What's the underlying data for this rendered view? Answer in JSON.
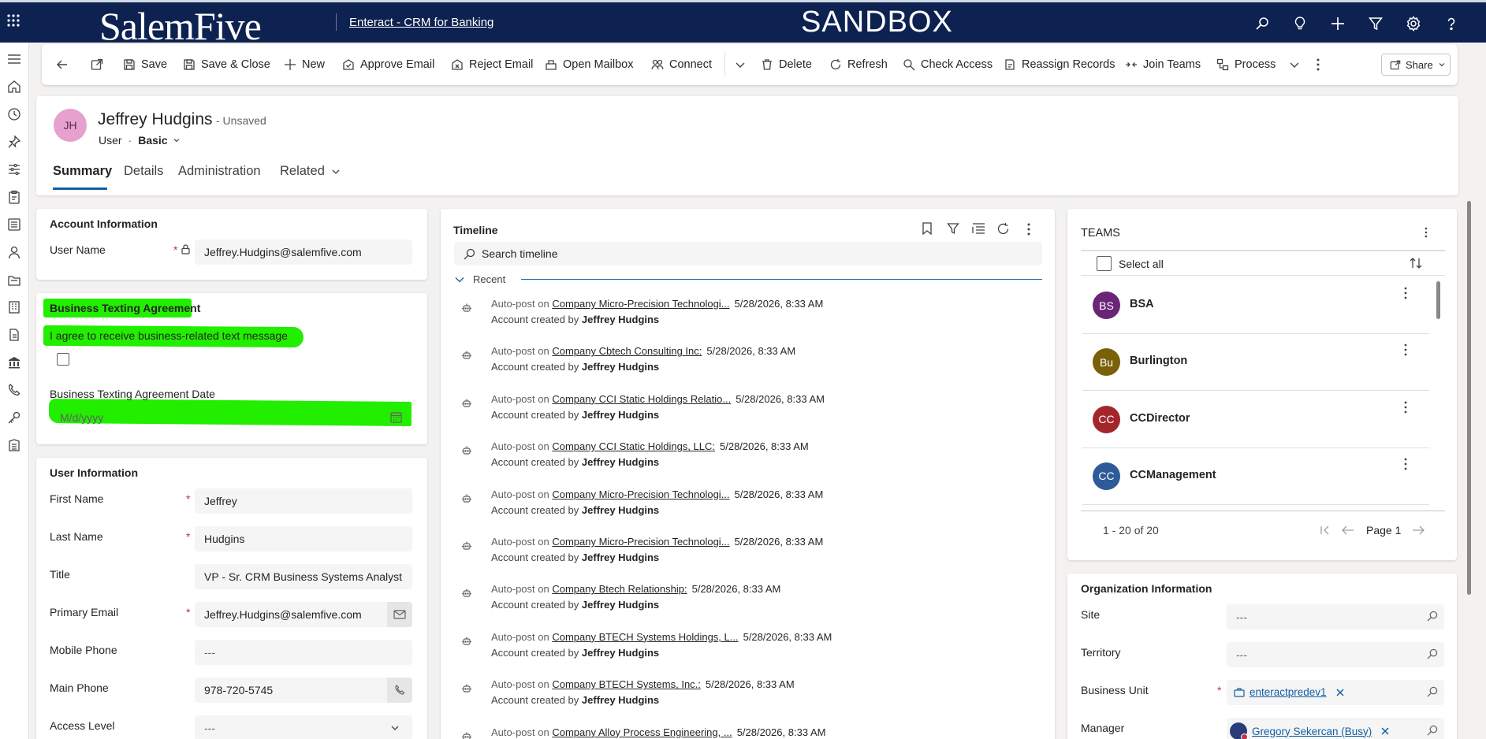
{
  "topbar": {
    "logo": "SalemFive",
    "app_name": "Enteract - CRM for Banking",
    "environment": "SANDBOX",
    "icons": [
      "search-icon",
      "lightbulb-icon",
      "plus-icon",
      "filter-icon",
      "gear-icon",
      "help-icon"
    ]
  },
  "commands": {
    "save": "Save",
    "save_close": "Save & Close",
    "new": "New",
    "approve_email": "Approve Email",
    "reject_email": "Reject Email",
    "open_mailbox": "Open Mailbox",
    "connect": "Connect",
    "delete": "Delete",
    "refresh": "Refresh",
    "check_access": "Check Access",
    "reassign_records": "Reassign Records",
    "join_teams": "Join Teams",
    "process": "Process",
    "share": "Share"
  },
  "header": {
    "initials": "JH",
    "full_name": "Jeffrey Hudgins",
    "status": "- Unsaved",
    "entity": "User",
    "separator": "·",
    "form": "Basic",
    "avatar_color": "#e6a1cf"
  },
  "tabs": [
    "Summary",
    "Details",
    "Administration",
    "Related"
  ],
  "account_info": {
    "title": "Account Information",
    "user_name_label": "User Name",
    "user_name_value": "Jeffrey.Hudgins@salemfive.com"
  },
  "texting": {
    "title": "Business Texting Agreement",
    "agree_label": "I agree to receive business-related text message",
    "date_label": "Business Texting Agreement Date",
    "date_placeholder": "M/d/yyyy",
    "highlight_color": "#22ee00"
  },
  "user_info": {
    "title": "User Information",
    "first_name_label": "First Name",
    "first_name": "Jeffrey",
    "last_name_label": "Last Name",
    "last_name": "Hudgins",
    "title_label": "Title",
    "title_value": "VP - Sr. CRM Business Systems Analyst",
    "email_label": "Primary Email",
    "email": "Jeffrey.Hudgins@salemfive.com",
    "mobile_label": "Mobile Phone",
    "mobile": "---",
    "main_phone_label": "Main Phone",
    "main_phone": "978-720-5745",
    "access_label": "Access Level",
    "access": "---"
  },
  "timeline": {
    "title": "Timeline",
    "search_placeholder": "Search timeline",
    "group": "Recent",
    "items": [
      {
        "prefix": "Auto-post on",
        "link": "Company Micro-Precision Technologi...",
        "when": "5/28/2026, 8:33 AM",
        "line2": "Account created by",
        "by": "Jeffrey Hudgins"
      },
      {
        "prefix": "Auto-post on",
        "link": "Company Cbtech Consulting Inc:",
        "when": "5/28/2026, 8:33 AM",
        "line2": "Account created by",
        "by": "Jeffrey Hudgins"
      },
      {
        "prefix": "Auto-post on",
        "link": "Company CCI Static Holdings Relatio...",
        "when": "5/28/2026, 8:33 AM",
        "line2": "Account created by",
        "by": "Jeffrey Hudgins"
      },
      {
        "prefix": "Auto-post on",
        "link": "Company CCI Static Holdings, LLC:",
        "when": "5/28/2026, 8:33 AM",
        "line2": "Account created by",
        "by": "Jeffrey Hudgins"
      },
      {
        "prefix": "Auto-post on",
        "link": "Company Micro-Precision Technologi...",
        "when": "5/28/2026, 8:33 AM",
        "line2": "Account created by",
        "by": "Jeffrey Hudgins"
      },
      {
        "prefix": "Auto-post on",
        "link": "Company Micro-Precision Technologi...",
        "when": "5/28/2026, 8:33 AM",
        "line2": "Account created by",
        "by": "Jeffrey Hudgins"
      },
      {
        "prefix": "Auto-post on",
        "link": "Company Btech Relationship:",
        "when": "5/28/2026, 8:33 AM",
        "line2": "Account created by",
        "by": "Jeffrey Hudgins"
      },
      {
        "prefix": "Auto-post on",
        "link": "Company BTECH Systems Holdings, L...",
        "when": "5/28/2026, 8:33 AM",
        "line2": "Account created by",
        "by": "Jeffrey Hudgins"
      },
      {
        "prefix": "Auto-post on",
        "link": "Company BTECH Systems, Inc.:",
        "when": "5/28/2026, 8:33 AM",
        "line2": "Account created by",
        "by": "Jeffrey Hudgins"
      },
      {
        "prefix": "Auto-post on",
        "link": "Company Alloy Process Engineering, ...",
        "when": "5/28/2026, 8:33 AM",
        "line2": "",
        "by": ""
      }
    ]
  },
  "teams": {
    "title": "TEAMS",
    "select_all": "Select all",
    "items": [
      {
        "initials": "BS",
        "name": "BSA",
        "color": "#6b2577"
      },
      {
        "initials": "Bu",
        "name": "Burlington",
        "color": "#7a6008"
      },
      {
        "initials": "CC",
        "name": "CCDirector",
        "color": "#a4262c"
      },
      {
        "initials": "CC",
        "name": "CCManagement",
        "color": "#2f5a9a"
      }
    ],
    "range": "1 - 20 of 20",
    "page": "Page 1"
  },
  "org_info": {
    "title": "Organization Information",
    "site_label": "Site",
    "site": "---",
    "territory_label": "Territory",
    "territory": "---",
    "bu_label": "Business Unit",
    "bu": "enteractpredev1",
    "manager_label": "Manager",
    "manager": "Gregory Sekercan (Busy)"
  }
}
